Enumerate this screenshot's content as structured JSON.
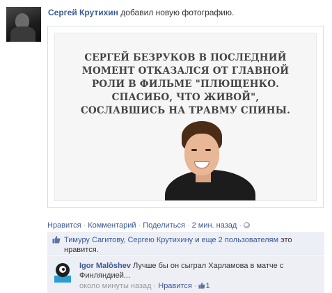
{
  "post": {
    "author": "Сергей Крутихин",
    "action": "добавил новую фотографию."
  },
  "photo": {
    "quote_lines": [
      "СЕРГЕЙ БЕЗРУКОВ В ПОСЛЕДНИЙ",
      "МОМЕНТ ОТКАЗАЛСЯ ОТ ГЛАВНОЙ",
      "РОЛИ В ФИЛЬМЕ \"ПЛЮЩЕНКО.",
      "СПАСИБО, ЧТО ЖИВОЙ\",",
      "СОСЛАВШИСЬ НА ТРАВМУ СПИНЫ."
    ]
  },
  "actions": {
    "like": "Нравится",
    "comment": "Комментарий",
    "share": "Поделиться",
    "time": "2 мин. назад",
    "separator": "·",
    "privacy_icon": "globe-icon"
  },
  "likes": {
    "icon": "thumbs-up-icon",
    "names": "Тимуру Сагитову, Сергею Крутихину",
    "connector": "и",
    "others": "еще 2 пользователям",
    "suffix": "это нравится."
  },
  "comment": {
    "author": "Igor Malôshev",
    "text": "Лучше бы он сыграл Харламова в матче с Финляндией...",
    "time": "около минуты назад",
    "like": "Нравится",
    "like_count": "1"
  },
  "colors": {
    "link": "#3b5998",
    "muted": "#999999",
    "likes_bg": "#eceff5"
  }
}
